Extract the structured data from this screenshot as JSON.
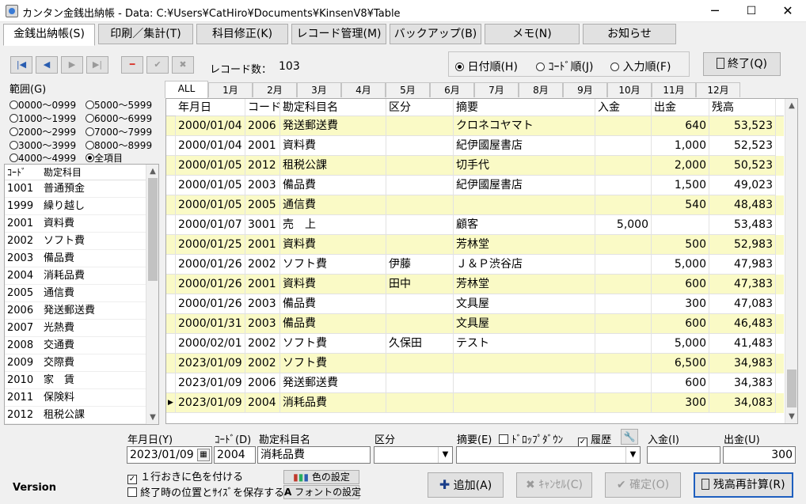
{
  "window": {
    "title": "カンタン金銭出納帳 - Data: C:¥Users¥CatHiro¥Documents¥KinsenV8¥Table",
    "minimize": "─",
    "maximize": "☐",
    "close": "✕"
  },
  "main_tabs": [
    {
      "label": "金銭出納帳(S)"
    },
    {
      "label": "印刷／集計(T)"
    },
    {
      "label": "科目修正(K)"
    },
    {
      "label": "レコード管理(M)"
    },
    {
      "label": "バックアップ(B)"
    },
    {
      "label": "メモ(N)"
    },
    {
      "label": "お知らせ"
    }
  ],
  "nav": {
    "first": "|◀",
    "prev": "◀",
    "next": "▶",
    "last": "▶|",
    "delete": "━",
    "confirm": "✔",
    "cancel": "✖"
  },
  "record_count": {
    "label": "レコード数：",
    "value": "103"
  },
  "sort": {
    "options": [
      "日付順(H)",
      "ｺｰﾄﾞ順(J)",
      "入力順(F)"
    ],
    "selected": 0
  },
  "exit_button": {
    "label": "終了(Q)"
  },
  "range": {
    "title": "範囲(G)",
    "options": [
      "0000～0999",
      "5000～5999",
      "1000～1999",
      "6000～6999",
      "2000～2999",
      "7000～7999",
      "3000～3999",
      "8000～8999",
      "4000～4999",
      "全項目"
    ],
    "selected": 9
  },
  "account_list": {
    "headers": [
      "ｺｰﾄﾞ",
      "勘定科目"
    ],
    "rows": [
      [
        "1001",
        "普通預金"
      ],
      [
        "1999",
        "繰り越し"
      ],
      [
        "2001",
        "資料費"
      ],
      [
        "2002",
        "ソフト費"
      ],
      [
        "2003",
        "備品費"
      ],
      [
        "2004",
        "消耗品費"
      ],
      [
        "2005",
        "通信費"
      ],
      [
        "2006",
        "発送郵送費"
      ],
      [
        "2007",
        "光熱費"
      ],
      [
        "2008",
        "交通費"
      ],
      [
        "2009",
        "交際費"
      ],
      [
        "2010",
        "家　賃"
      ],
      [
        "2011",
        "保険料"
      ],
      [
        "2012",
        "租税公課"
      ]
    ]
  },
  "month_tabs": [
    "ALL",
    "1月",
    "2月",
    "3月",
    "4月",
    "5月",
    "6月",
    "7月",
    "8月",
    "9月",
    "10月",
    "11月",
    "12月"
  ],
  "grid": {
    "headers": [
      "年月日",
      "コード",
      "勘定科目名",
      "区分",
      "摘要",
      "入金",
      "出金",
      "残高"
    ],
    "rows": [
      {
        "date": "2000/01/04",
        "code": "2006",
        "account": "発送郵送費",
        "kubun": "",
        "tekiyo": "クロネコヤマト",
        "in": "",
        "out": "640",
        "balance": "53,523"
      },
      {
        "date": "2000/01/04",
        "code": "2001",
        "account": "資料費",
        "kubun": "",
        "tekiyo": "紀伊國屋書店",
        "in": "",
        "out": "1,000",
        "balance": "52,523"
      },
      {
        "date": "2000/01/05",
        "code": "2012",
        "account": "租税公課",
        "kubun": "",
        "tekiyo": "切手代",
        "in": "",
        "out": "2,000",
        "balance": "50,523"
      },
      {
        "date": "2000/01/05",
        "code": "2003",
        "account": "備品費",
        "kubun": "",
        "tekiyo": "紀伊國屋書店",
        "in": "",
        "out": "1,500",
        "balance": "49,023"
      },
      {
        "date": "2000/01/05",
        "code": "2005",
        "account": "通信費",
        "kubun": "",
        "tekiyo": "",
        "in": "",
        "out": "540",
        "balance": "48,483"
      },
      {
        "date": "2000/01/07",
        "code": "3001",
        "account": "売　上",
        "kubun": "",
        "tekiyo": "顧客",
        "in": "5,000",
        "out": "",
        "balance": "53,483"
      },
      {
        "date": "2000/01/25",
        "code": "2001",
        "account": "資料費",
        "kubun": "",
        "tekiyo": "芳林堂",
        "in": "",
        "out": "500",
        "balance": "52,983"
      },
      {
        "date": "2000/01/26",
        "code": "2002",
        "account": "ソフト費",
        "kubun": "伊藤",
        "tekiyo": "Ｊ＆Ｐ渋谷店",
        "in": "",
        "out": "5,000",
        "balance": "47,983"
      },
      {
        "date": "2000/01/26",
        "code": "2001",
        "account": "資料費",
        "kubun": "田中",
        "tekiyo": "芳林堂",
        "in": "",
        "out": "600",
        "balance": "47,383"
      },
      {
        "date": "2000/01/26",
        "code": "2003",
        "account": "備品費",
        "kubun": "",
        "tekiyo": "文具屋",
        "in": "",
        "out": "300",
        "balance": "47,083"
      },
      {
        "date": "2000/01/31",
        "code": "2003",
        "account": "備品費",
        "kubun": "",
        "tekiyo": "文具屋",
        "in": "",
        "out": "600",
        "balance": "46,483"
      },
      {
        "date": "2000/02/01",
        "code": "2002",
        "account": "ソフト費",
        "kubun": "久保田",
        "tekiyo": "テスト",
        "in": "",
        "out": "5,000",
        "balance": "41,483"
      },
      {
        "date": "2023/01/09",
        "code": "2002",
        "account": "ソフト費",
        "kubun": "",
        "tekiyo": "",
        "in": "",
        "out": "6,500",
        "balance": "34,983"
      },
      {
        "date": "2023/01/09",
        "code": "2006",
        "account": "発送郵送費",
        "kubun": "",
        "tekiyo": "",
        "in": "",
        "out": "600",
        "balance": "34,383"
      },
      {
        "date": "2023/01/09",
        "code": "2004",
        "account": "消耗品費",
        "kubun": "",
        "tekiyo": "",
        "in": "",
        "out": "300",
        "balance": "34,083"
      }
    ],
    "current_row_marker": "▶"
  },
  "form": {
    "labels": {
      "date": "年月日(Y)",
      "code": "ｺｰﾄﾞ(D)",
      "account": "勘定科目名",
      "kubun": "区分",
      "tekiyo": "摘要(E)",
      "dropdown": "ﾄﾞﾛｯﾌﾟﾀﾞｳﾝ",
      "history": "履歴",
      "in": "入金(I)",
      "out": "出金(U)"
    },
    "values": {
      "date": "2023/01/09",
      "code": "2004",
      "account": "消耗品費",
      "kubun": "",
      "tekiyo": "",
      "in": "",
      "out": "300"
    },
    "calendar_icon": "▦",
    "history_checked": true,
    "dropdown_checked": false
  },
  "options": {
    "alternate_color": "１行おきに色を付ける",
    "alternate_checked": true,
    "save_position": "終了時の位置とｻｲｽﾞを保存する",
    "save_checked": false
  },
  "buttons": {
    "color_setting": "色の設定",
    "font_setting": "フォントの設定",
    "add": "追加(A)",
    "cancel": "ｷｬﾝｾﾙ(C)",
    "confirm": "確定(O)",
    "recalc": "残高再計算(R)"
  },
  "version_label": "Version",
  "colors": {
    "alt_row": "#fafac6",
    "accent": "#2a5db0"
  }
}
